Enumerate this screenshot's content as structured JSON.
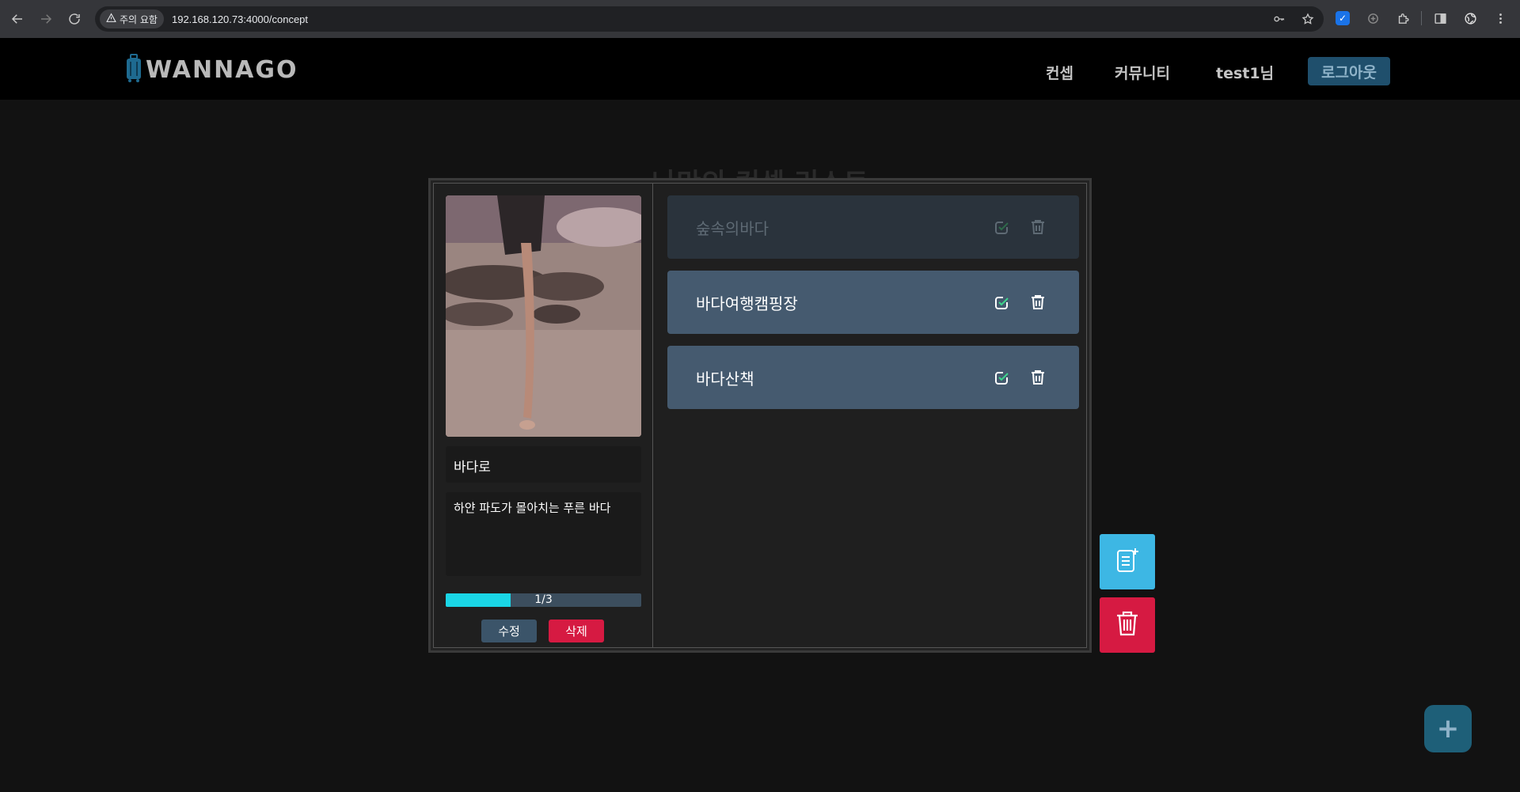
{
  "browser": {
    "warning_chip": "주의 요함",
    "url": "192.168.120.73:4000/concept"
  },
  "header": {
    "logo_text": "WANNAGO",
    "menu": [
      {
        "label": "컨셉"
      },
      {
        "label": "커뮤니티"
      },
      {
        "label": "test1님"
      }
    ],
    "logout_label": "로그아웃"
  },
  "page": {
    "heading": "나만의 컨셉 리스트"
  },
  "concept": {
    "title": "바다로",
    "description": "하얀 파도가 몰아치는 푸른 바다",
    "progress": {
      "completed": 1,
      "total": 3,
      "label": "1/3"
    },
    "edit_label": "수정",
    "delete_label": "삭제"
  },
  "items": [
    {
      "label": "숲속의바다",
      "done": true
    },
    {
      "label": "바다여행캠핑장",
      "done": false
    },
    {
      "label": "바다산책",
      "done": false
    }
  ],
  "colors": {
    "accent": "#3db7e4",
    "danger": "#d61a42",
    "progress": "#1ad6e6",
    "item_active": "#455a6f",
    "item_done": "#2a333c"
  },
  "icons": {
    "add_list": "add-list-icon",
    "trash": "trash-icon",
    "check": "check-icon",
    "plus": "+"
  }
}
